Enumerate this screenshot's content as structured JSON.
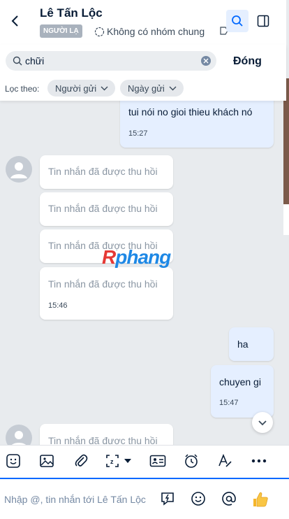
{
  "header": {
    "contact_name": "Lê Tấn Lộc",
    "stranger_badge": "NGƯỜI LẠ",
    "mutual_groups": "Không có nhóm chung"
  },
  "search": {
    "query": "chữi",
    "close_label": "Đóng",
    "filter_label": "Lọc theo:",
    "filter_sender": "Người gửi",
    "filter_date": "Ngày gửi"
  },
  "messages": {
    "m1": {
      "text": "tui nói no gioi thieu khách nó",
      "time": "15:27"
    },
    "recalled_1": {
      "text": "Tin nhắn đã được thu hồi"
    },
    "recalled_2": {
      "text": "Tin nhắn đã được thu hồi"
    },
    "recalled_3": {
      "text": "Tin nhắn đã được thu hồi"
    },
    "recalled_4": {
      "text": "Tin nhắn đã được thu hồi",
      "time": "15:46"
    },
    "m2": {
      "text": "ha"
    },
    "m3": {
      "text": "chuyen gi",
      "time": "15:47"
    },
    "recalled_5": {
      "text": "Tin nhắn đã được thu hồi"
    }
  },
  "watermark": {
    "part1": "R",
    "part2": "phang"
  },
  "composer": {
    "placeholder": "Nhập @, tin nhắn tới Lê Tấn Lộc"
  },
  "icons": {
    "back": "chevron-left-icon",
    "search": "search-icon",
    "panel": "side-panel-icon",
    "sticker": "sticker-icon",
    "image": "image-icon",
    "attach": "paperclip-icon",
    "screenshot": "screenshot-icon",
    "contact_card": "contact-card-icon",
    "reminder": "alarm-clock-icon",
    "format": "text-format-icon",
    "more": "more-icon",
    "quick_message": "quick-message-icon",
    "emoji": "emoji-icon",
    "mention": "mention-icon",
    "like": "thumbs-up-icon"
  },
  "colors": {
    "accent": "#0068ff",
    "my_bubble": "#e5efff",
    "their_bubble": "#ffffff",
    "chat_background": "#e8ebee"
  }
}
